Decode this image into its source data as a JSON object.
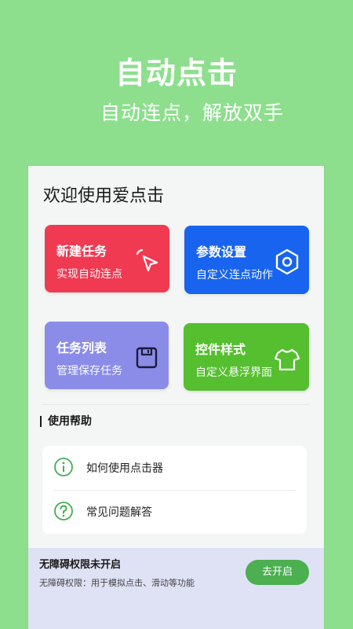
{
  "hero": {
    "title": "自动点击",
    "subtitle": "自动连点，解放双手"
  },
  "welcome": "欢迎使用爱点击",
  "cards": [
    {
      "title": "新建任务",
      "subtitle": "实现自动连点",
      "icon": "cursor-click-icon",
      "color": "#f03a52"
    },
    {
      "title": "参数设置",
      "subtitle": "自定义连点动作",
      "icon": "hexagon-settings-icon",
      "color": "#1864ef"
    },
    {
      "title": "任务列表",
      "subtitle": "管理保存任务",
      "icon": "save-icon",
      "color": "#8a8ce8"
    },
    {
      "title": "控件样式",
      "subtitle": "自定义悬浮界面",
      "icon": "tshirt-icon",
      "color": "#55bf2f"
    }
  ],
  "help": {
    "title": "使用帮助",
    "items": [
      {
        "label": "如何使用点击器",
        "icon": "info-icon"
      },
      {
        "label": "常见问题解答",
        "icon": "question-icon"
      }
    ]
  },
  "accessibility": {
    "title": "无障碍权限未开启",
    "description": "无障碍权限：用于模拟点击、滑动等功能",
    "button": "去开启"
  },
  "colors": {
    "background": "#8ddf8d",
    "accent_green": "#4caf50",
    "help_icon": "#3fae4d"
  }
}
